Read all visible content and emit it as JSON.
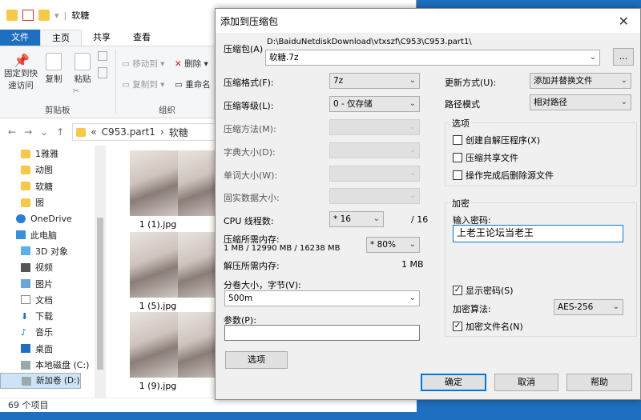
{
  "explorer": {
    "title": "软糖",
    "tabs": [
      "文件",
      "主页",
      "共享",
      "查看"
    ],
    "ribbon": {
      "pin_label": "固定到快速访问",
      "copy": "复制",
      "paste": "粘贴",
      "move_to": "移动到",
      "copy_to": "复制到",
      "delete": "删除",
      "rename": "重命名",
      "clipboard_group": "剪贴板",
      "organize_group": "组织"
    },
    "address": {
      "prefix": "«",
      "parts": [
        "C953.part1",
        "软糖"
      ]
    },
    "nav": [
      {
        "label": "1雅雅",
        "icon": "folder-icon"
      },
      {
        "label": "动图",
        "icon": "folder-icon"
      },
      {
        "label": "软糖",
        "icon": "folder-icon"
      },
      {
        "label": "图",
        "icon": "folder-icon"
      },
      {
        "label": "OneDrive",
        "icon": "cloud-icon"
      },
      {
        "label": "此电脑",
        "icon": "computer-icon"
      },
      {
        "label": "3D 对象",
        "icon": "cube-icon"
      },
      {
        "label": "视频",
        "icon": "video-icon"
      },
      {
        "label": "图片",
        "icon": "picture-icon"
      },
      {
        "label": "文档",
        "icon": "document-icon"
      },
      {
        "label": "下载",
        "icon": "download-icon"
      },
      {
        "label": "音乐",
        "icon": "music-icon"
      },
      {
        "label": "桌面",
        "icon": "desktop-icon"
      },
      {
        "label": "本地磁盘 (C:)",
        "icon": "drive-icon"
      },
      {
        "label": "新加卷 (D:)",
        "icon": "drive-icon"
      }
    ],
    "files": [
      "1 (1).jpg",
      "1 (5).jpg",
      "1 (9).jpg"
    ],
    "status": "69 个项目"
  },
  "dialog": {
    "title": "添加到压缩包",
    "archive_label": "压缩包(A)",
    "archive_path": "D:\\BaiduNetdiskDownload\\vtxszf\\C953\\C953.part1\\",
    "archive_name": "软糖.7z",
    "browse": "...",
    "format_label": "压缩格式(F):",
    "format_value": "7z",
    "level_label": "压缩等级(L):",
    "level_value": "0 - 仅存储",
    "method_label": "压缩方法(M):",
    "dict_label": "字典大小(D):",
    "word_label": "单词大小(W):",
    "solid_label": "固实数据大小:",
    "threads_label": "CPU 线程数:",
    "threads_value": "* 16",
    "threads_total": "/ 16",
    "mem_label": "压缩所需内存:",
    "mem_value": "1 MB / 12990 MB / 16238 MB",
    "mem_select": "* 80%",
    "decomp_label": "解压所需内存:",
    "decomp_value": "1 MB",
    "split_label": "分卷大小，字节(V):",
    "split_value": "500m",
    "params_label": "参数(P):",
    "options_button": "选项",
    "update_label": "更新方式(U):",
    "update_value": "添加并替换文件",
    "pathmode_label": "路径模式",
    "pathmode_value": "相对路径",
    "options_group": "选项",
    "opt_sfx": "创建自解压程序(X)",
    "opt_shared": "压缩共享文件",
    "opt_delete": "操作完成后删除源文件",
    "encrypt_group": "加密",
    "pwd_label": "输入密码:",
    "pwd_value": "上老王论坛当老王",
    "show_pwd": "显示密码(S)",
    "enc_method_label": "加密算法:",
    "enc_method_value": "AES-256",
    "enc_names": "加密文件名(N)",
    "ok": "确定",
    "cancel": "取消",
    "help": "帮助"
  },
  "colors": {
    "accent": "#0078d7",
    "file_tab": "#1e6fbf",
    "desktop": "#1e6fbf"
  }
}
